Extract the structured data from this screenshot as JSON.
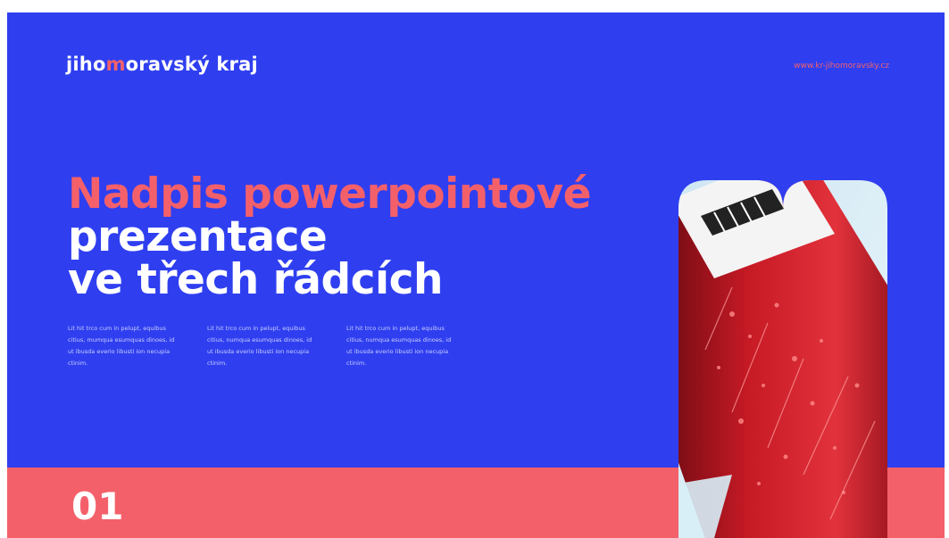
{
  "brand": {
    "logo_prefix": "jiho",
    "logo_mid": "m",
    "logo_suffix": "oravský kraj",
    "site": "www.kr-jihomoravsky.cz"
  },
  "heading": {
    "line1": "Nadpis powerpointové",
    "line2": "prezentace",
    "line3": "ve třech řádcích"
  },
  "columns": [
    "Lit hit trco cum in pelupt, equibus citius, mumqua esumquas dinoes, id ut ibusda everio libusti ion necupia ctinim.",
    "Lit hit trco cum in pelupt, equibus citius, numqua esumquas dinoes, id ut ibusda everio libusti ion necupia ctinim.",
    "Lit hit trco cum in pelupt, equibus citius, numqua esumquas dinoes, id ut ibusda everio libusti ion necupia ctinim."
  ],
  "slide_number": "01",
  "colors": {
    "background": "#2f3ff0",
    "accent": "#f4606a",
    "text": "#ffffff"
  },
  "image": {
    "icon": "blood-test-tube-photo"
  }
}
